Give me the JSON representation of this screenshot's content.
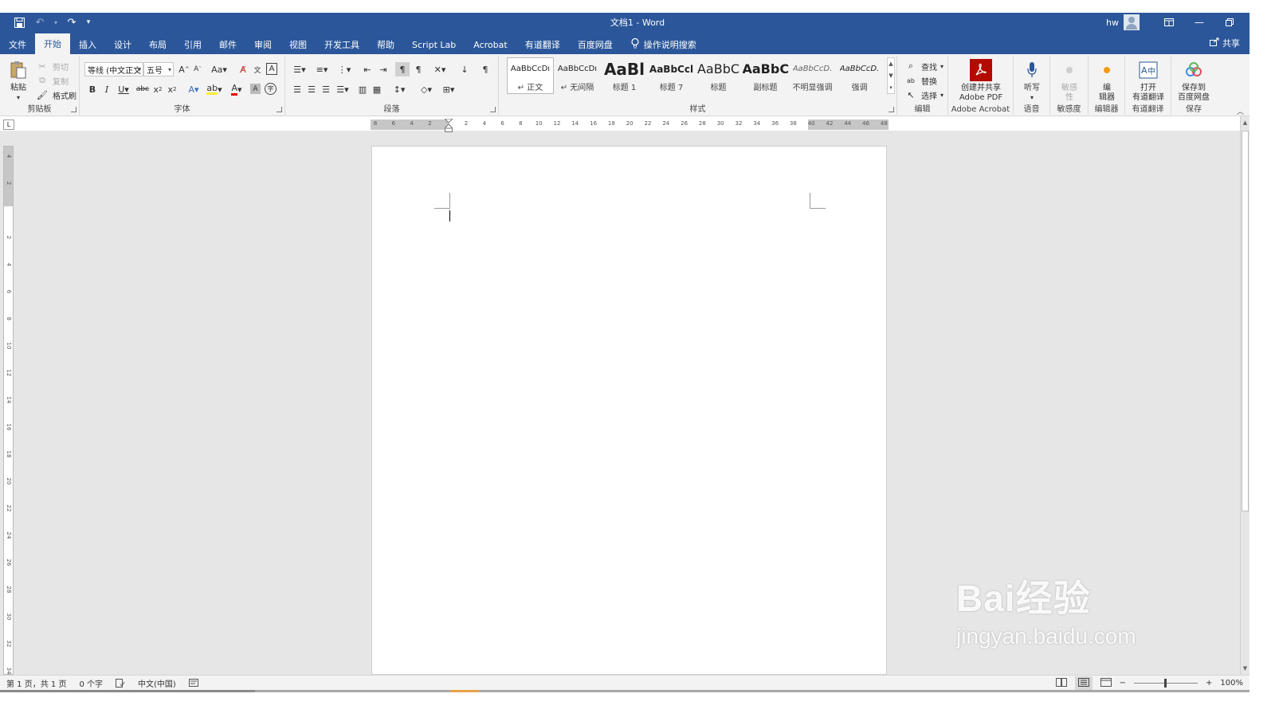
{
  "app": {
    "title": "文档1 - Word",
    "user": "hw"
  },
  "tabs": [
    "文件",
    "开始",
    "插入",
    "设计",
    "布局",
    "引用",
    "邮件",
    "审阅",
    "视图",
    "开发工具",
    "帮助",
    "Script Lab",
    "Acrobat",
    "有道翻译",
    "百度网盘"
  ],
  "active_tab": "开始",
  "tell_me": "操作说明搜索",
  "share_label": "共享",
  "clipboard": {
    "paste": "粘贴",
    "cut": "剪切",
    "copy": "复制",
    "format_painter": "格式刷",
    "label": "剪贴板"
  },
  "font": {
    "name": "等线 (中文正文",
    "size": "五号",
    "label": "字体"
  },
  "paragraph": {
    "label": "段落"
  },
  "styles": {
    "label": "样式",
    "items": [
      {
        "sample": "AaBbCcDı",
        "name": "↵ 正文"
      },
      {
        "sample": "AaBbCcDı",
        "name": "↵ 无间隔"
      },
      {
        "sample": "AaBl",
        "name": "标题 1"
      },
      {
        "sample": "AaBbCcl",
        "name": "标题 7"
      },
      {
        "sample": "AaBbC",
        "name": "标题"
      },
      {
        "sample": "AaBbC",
        "name": "副标题"
      },
      {
        "sample": "AaBbCcD.",
        "name": "不明显强调"
      },
      {
        "sample": "AaBbCcD.",
        "name": "强调"
      }
    ]
  },
  "editing": {
    "find": "查找",
    "replace": "替换",
    "select": "选择",
    "label": "编辑"
  },
  "acrobat": {
    "button": "创建并共享\nAdobe PDF",
    "label": "Adobe Acrobat"
  },
  "voice": {
    "button": "听写",
    "label": "语音"
  },
  "sensitivity": {
    "button": "敏感\n性",
    "label": "敏感度"
  },
  "editor": {
    "button": "编\n辑器",
    "label": "编辑器"
  },
  "youdao": {
    "button": "打开\n有道翻译",
    "label": "有道翻译"
  },
  "baidu": {
    "button": "保存到\n百度网盘",
    "label": "保存"
  },
  "ruler": {
    "h_labels": [
      "8",
      "6",
      "4",
      "2",
      "",
      "2",
      "4",
      "6",
      "8",
      "10",
      "12",
      "14",
      "16",
      "18",
      "20",
      "22",
      "24",
      "26",
      "28",
      "30",
      "32",
      "34",
      "36",
      "38",
      "40",
      "42",
      "44",
      "46",
      "48"
    ],
    "v_labels": [
      "4",
      "2",
      "",
      "2",
      "4",
      "6",
      "8",
      "10",
      "12",
      "14",
      "16",
      "18",
      "20",
      "22",
      "24",
      "26",
      "28",
      "30",
      "32",
      "34"
    ]
  },
  "status": {
    "page": "第 1 页，共 1 页",
    "words": "0 个字",
    "language": "中文(中国)",
    "zoom": "100%"
  },
  "watermark": {
    "main": "Bai经验",
    "sub": "jingyan.baidu.com"
  },
  "colors": {
    "title_bar": "#2b579a",
    "ribbon": "#f3f3f3",
    "workspace": "#e6e6e6"
  }
}
